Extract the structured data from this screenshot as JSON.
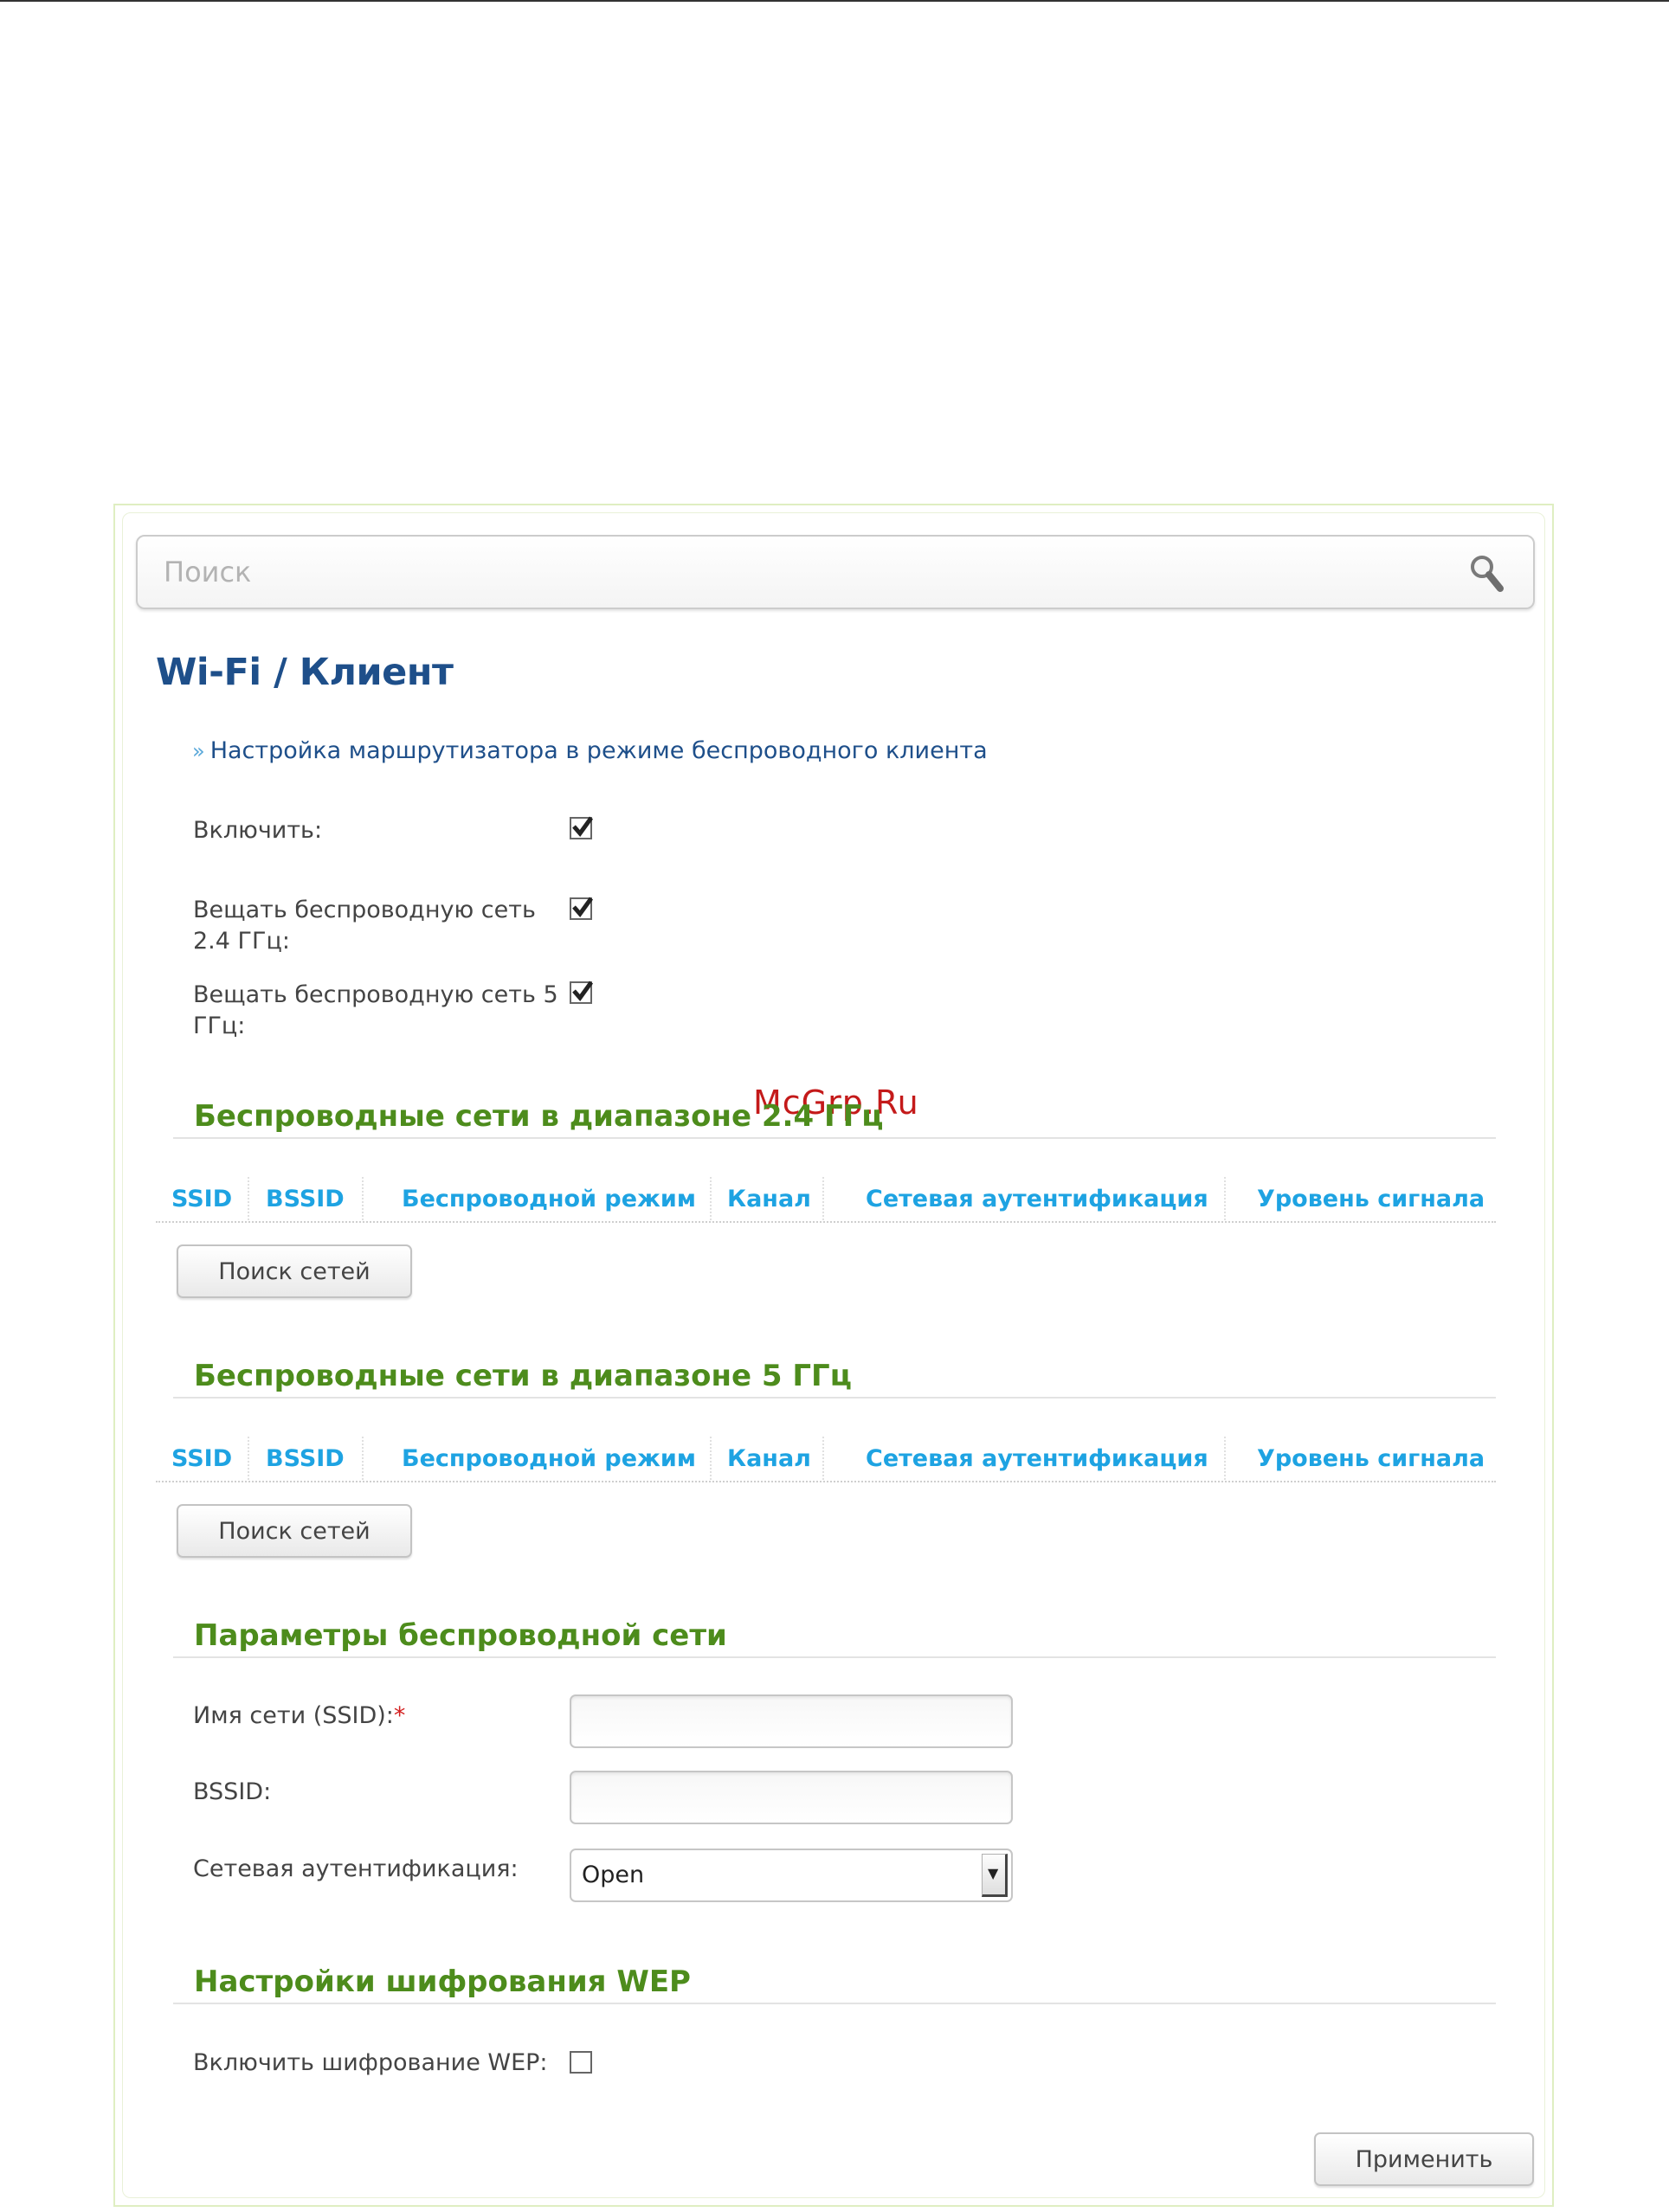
{
  "search": {
    "placeholder": "Поиск"
  },
  "breadcrumb": {
    "section": "Wi-Fi",
    "separator": " / ",
    "page": "Клиент"
  },
  "help_link": {
    "text": "Настройка маршрутизатора в режиме беспроводного клиента"
  },
  "options": [
    {
      "label_line1": "Включить:",
      "label_line2": "",
      "checked": true
    },
    {
      "label_line1": "Вещать беспроводную сеть",
      "label_line2": "2.4 ГГц:",
      "checked": true
    },
    {
      "label_line1": "Вещать беспроводную сеть 5",
      "label_line2": "ГГц:",
      "checked": true
    }
  ],
  "networks_24": {
    "title": "Беспроводные сети в диапазоне 2.4 ГГц",
    "columns": [
      "SSID",
      "BSSID",
      "Беспроводной режим",
      "Канал",
      "Сетевая аутентификация",
      "Уровень сигнала"
    ],
    "scan_button": "Поиск сетей"
  },
  "networks_5": {
    "title": "Беспроводные сети в диапазоне 5 ГГц",
    "columns": [
      "SSID",
      "BSSID",
      "Беспроводной режим",
      "Канал",
      "Сетевая аутентификация",
      "Уровень сигнала"
    ],
    "scan_button": "Поиск сетей"
  },
  "wireless_params": {
    "title": "Параметры беспроводной сети",
    "ssid_label": "Имя сети (SSID):",
    "required_mark": "*",
    "ssid_value": "",
    "bssid_label": "BSSID:",
    "bssid_value": "",
    "auth_label": "Сетевая аутентификация:",
    "auth_value": "Open"
  },
  "wep": {
    "title": "Настройки шифрования WEP",
    "enable_label": "Включить шифрование WEP:",
    "enabled": false
  },
  "apply_button": "Применить",
  "watermark": "McGrp.Ru",
  "colors": {
    "title_blue": "#1e4f8a",
    "section_green": "#4d8c1c",
    "column_blue": "#1ea3e2",
    "watermark_red": "#c41a1a"
  }
}
